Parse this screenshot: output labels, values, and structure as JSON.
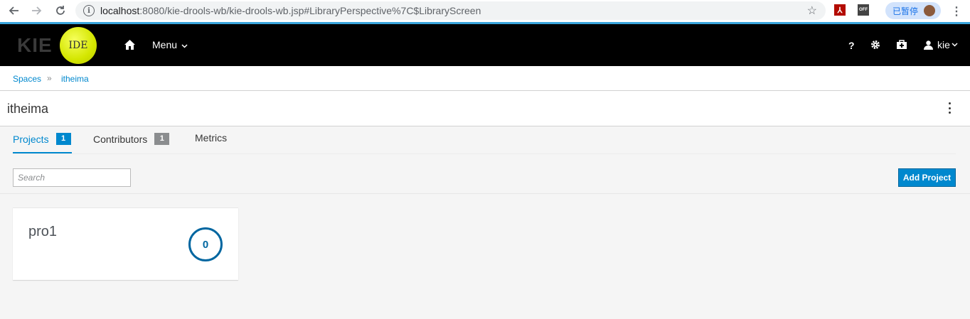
{
  "browser": {
    "url_host": "localhost",
    "url_rest": ":8080/kie-drools-wb/kie-drools-wb.jsp#LibraryPerspective%7C$LibraryScreen",
    "paused_label": "已暂停",
    "ext_off_label": "OFF"
  },
  "navbar": {
    "logo_text": "KIE",
    "logo_badge": "IDE",
    "menu_label": "Menu",
    "help_label": "?",
    "user_label": "kie"
  },
  "breadcrumb": {
    "items": [
      {
        "label": "Spaces"
      },
      {
        "label": "itheima"
      }
    ],
    "separator": "»"
  },
  "page": {
    "title": "itheima"
  },
  "tabs": [
    {
      "label": "Projects",
      "count": "1",
      "active": true
    },
    {
      "label": "Contributors",
      "count": "1",
      "active": false
    },
    {
      "label": "Metrics",
      "count": null,
      "active": false
    }
  ],
  "toolbar": {
    "search_placeholder": "Search",
    "add_project_label": "Add Project"
  },
  "projects": [
    {
      "name": "pro1",
      "count": "0"
    }
  ],
  "colors": {
    "accent": "#0088ce",
    "navbar_bg": "#000000",
    "chrome_accent_line": "#39a5dc"
  }
}
